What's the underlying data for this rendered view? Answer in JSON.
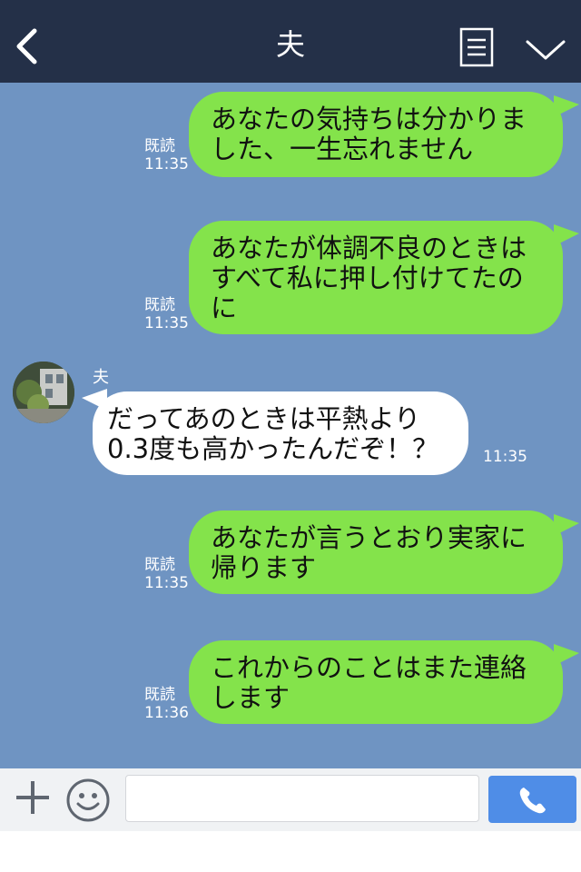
{
  "header": {
    "title": "夫",
    "back_icon": "chevron-left-icon",
    "menu_icon": "document-menu-icon",
    "expand_icon": "chevron-down-icon"
  },
  "colors": {
    "header_bg": "#243048",
    "chat_bg": "#6f94c2",
    "outgoing_bubble": "#84e34b",
    "incoming_bubble": "#ffffff",
    "send_button": "#4f8de7"
  },
  "messages": [
    {
      "direction": "out",
      "lines": [
        "あなたの気持ちは分かりま",
        "した、一生忘れません"
      ],
      "read": "既読",
      "time": "11:35"
    },
    {
      "direction": "out",
      "lines": [
        "あなたが体調不良のときは",
        "すべて私に押し付けてたの",
        "に"
      ],
      "read": "既読",
      "time": "11:35"
    },
    {
      "direction": "in",
      "sender": "夫",
      "lines": [
        "だってあのときは平熱より",
        "0.3度も高かったんだぞ！？"
      ],
      "time": "11:35"
    },
    {
      "direction": "out",
      "lines": [
        "あなたが言うとおり実家に",
        "帰ります"
      ],
      "read": "既読",
      "time": "11:35"
    },
    {
      "direction": "out",
      "lines": [
        "これからのことはまた連絡",
        "します"
      ],
      "read": "既読",
      "time": "11:36"
    }
  ],
  "input_bar": {
    "plus_icon": "plus-icon",
    "emoji_icon": "smiley-icon",
    "placeholder": "",
    "value": "",
    "send_icon": "phone-icon"
  }
}
